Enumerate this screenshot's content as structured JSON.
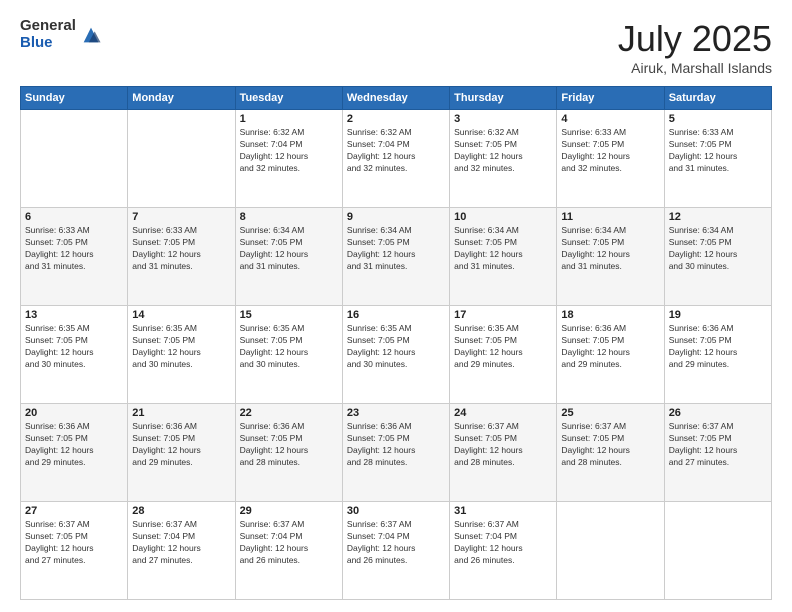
{
  "header": {
    "logo_general": "General",
    "logo_blue": "Blue",
    "month_title": "July 2025",
    "location": "Airuk, Marshall Islands"
  },
  "days_of_week": [
    "Sunday",
    "Monday",
    "Tuesday",
    "Wednesday",
    "Thursday",
    "Friday",
    "Saturday"
  ],
  "weeks": [
    [
      {
        "day": "",
        "info": ""
      },
      {
        "day": "",
        "info": ""
      },
      {
        "day": "1",
        "info": "Sunrise: 6:32 AM\nSunset: 7:04 PM\nDaylight: 12 hours\nand 32 minutes."
      },
      {
        "day": "2",
        "info": "Sunrise: 6:32 AM\nSunset: 7:04 PM\nDaylight: 12 hours\nand 32 minutes."
      },
      {
        "day": "3",
        "info": "Sunrise: 6:32 AM\nSunset: 7:05 PM\nDaylight: 12 hours\nand 32 minutes."
      },
      {
        "day": "4",
        "info": "Sunrise: 6:33 AM\nSunset: 7:05 PM\nDaylight: 12 hours\nand 32 minutes."
      },
      {
        "day": "5",
        "info": "Sunrise: 6:33 AM\nSunset: 7:05 PM\nDaylight: 12 hours\nand 31 minutes."
      }
    ],
    [
      {
        "day": "6",
        "info": "Sunrise: 6:33 AM\nSunset: 7:05 PM\nDaylight: 12 hours\nand 31 minutes."
      },
      {
        "day": "7",
        "info": "Sunrise: 6:33 AM\nSunset: 7:05 PM\nDaylight: 12 hours\nand 31 minutes."
      },
      {
        "day": "8",
        "info": "Sunrise: 6:34 AM\nSunset: 7:05 PM\nDaylight: 12 hours\nand 31 minutes."
      },
      {
        "day": "9",
        "info": "Sunrise: 6:34 AM\nSunset: 7:05 PM\nDaylight: 12 hours\nand 31 minutes."
      },
      {
        "day": "10",
        "info": "Sunrise: 6:34 AM\nSunset: 7:05 PM\nDaylight: 12 hours\nand 31 minutes."
      },
      {
        "day": "11",
        "info": "Sunrise: 6:34 AM\nSunset: 7:05 PM\nDaylight: 12 hours\nand 31 minutes."
      },
      {
        "day": "12",
        "info": "Sunrise: 6:34 AM\nSunset: 7:05 PM\nDaylight: 12 hours\nand 30 minutes."
      }
    ],
    [
      {
        "day": "13",
        "info": "Sunrise: 6:35 AM\nSunset: 7:05 PM\nDaylight: 12 hours\nand 30 minutes."
      },
      {
        "day": "14",
        "info": "Sunrise: 6:35 AM\nSunset: 7:05 PM\nDaylight: 12 hours\nand 30 minutes."
      },
      {
        "day": "15",
        "info": "Sunrise: 6:35 AM\nSunset: 7:05 PM\nDaylight: 12 hours\nand 30 minutes."
      },
      {
        "day": "16",
        "info": "Sunrise: 6:35 AM\nSunset: 7:05 PM\nDaylight: 12 hours\nand 30 minutes."
      },
      {
        "day": "17",
        "info": "Sunrise: 6:35 AM\nSunset: 7:05 PM\nDaylight: 12 hours\nand 29 minutes."
      },
      {
        "day": "18",
        "info": "Sunrise: 6:36 AM\nSunset: 7:05 PM\nDaylight: 12 hours\nand 29 minutes."
      },
      {
        "day": "19",
        "info": "Sunrise: 6:36 AM\nSunset: 7:05 PM\nDaylight: 12 hours\nand 29 minutes."
      }
    ],
    [
      {
        "day": "20",
        "info": "Sunrise: 6:36 AM\nSunset: 7:05 PM\nDaylight: 12 hours\nand 29 minutes."
      },
      {
        "day": "21",
        "info": "Sunrise: 6:36 AM\nSunset: 7:05 PM\nDaylight: 12 hours\nand 29 minutes."
      },
      {
        "day": "22",
        "info": "Sunrise: 6:36 AM\nSunset: 7:05 PM\nDaylight: 12 hours\nand 28 minutes."
      },
      {
        "day": "23",
        "info": "Sunrise: 6:36 AM\nSunset: 7:05 PM\nDaylight: 12 hours\nand 28 minutes."
      },
      {
        "day": "24",
        "info": "Sunrise: 6:37 AM\nSunset: 7:05 PM\nDaylight: 12 hours\nand 28 minutes."
      },
      {
        "day": "25",
        "info": "Sunrise: 6:37 AM\nSunset: 7:05 PM\nDaylight: 12 hours\nand 28 minutes."
      },
      {
        "day": "26",
        "info": "Sunrise: 6:37 AM\nSunset: 7:05 PM\nDaylight: 12 hours\nand 27 minutes."
      }
    ],
    [
      {
        "day": "27",
        "info": "Sunrise: 6:37 AM\nSunset: 7:05 PM\nDaylight: 12 hours\nand 27 minutes."
      },
      {
        "day": "28",
        "info": "Sunrise: 6:37 AM\nSunset: 7:04 PM\nDaylight: 12 hours\nand 27 minutes."
      },
      {
        "day": "29",
        "info": "Sunrise: 6:37 AM\nSunset: 7:04 PM\nDaylight: 12 hours\nand 26 minutes."
      },
      {
        "day": "30",
        "info": "Sunrise: 6:37 AM\nSunset: 7:04 PM\nDaylight: 12 hours\nand 26 minutes."
      },
      {
        "day": "31",
        "info": "Sunrise: 6:37 AM\nSunset: 7:04 PM\nDaylight: 12 hours\nand 26 minutes."
      },
      {
        "day": "",
        "info": ""
      },
      {
        "day": "",
        "info": ""
      }
    ]
  ]
}
